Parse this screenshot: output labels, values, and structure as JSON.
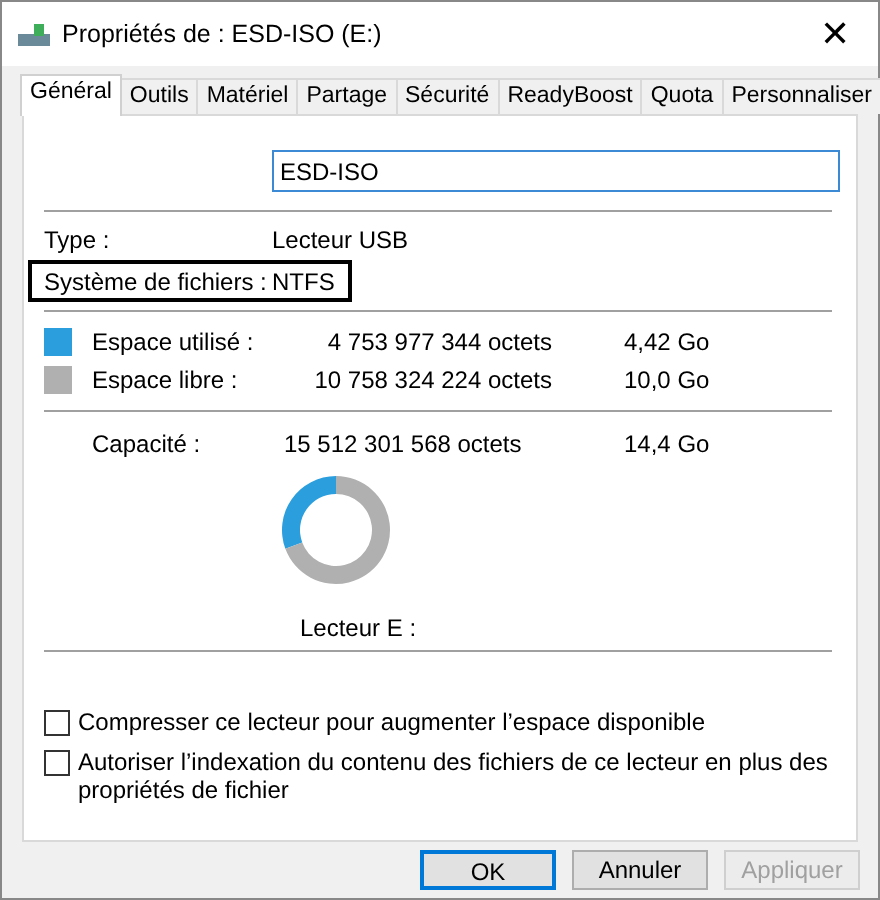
{
  "window": {
    "title": "Propriétés de : ESD-ISO (E:)",
    "close": "✕"
  },
  "tabs": [
    {
      "label": "Général",
      "selected": true
    },
    {
      "label": "Outils",
      "selected": false
    },
    {
      "label": "Matériel",
      "selected": false
    },
    {
      "label": "Partage",
      "selected": false
    },
    {
      "label": "Sécurité",
      "selected": false
    },
    {
      "label": "ReadyBoost",
      "selected": false
    },
    {
      "label": "Quota",
      "selected": false
    },
    {
      "label": "Personnaliser",
      "selected": false
    }
  ],
  "name_field": {
    "value": "ESD-ISO"
  },
  "properties": [
    {
      "label": "Type :",
      "value": "Lecteur USB",
      "highlighted": false
    },
    {
      "label": "Système de fichiers :",
      "value": "NTFS",
      "highlighted": true
    }
  ],
  "space": [
    {
      "label": "Espace utilisé :",
      "bytes": "4 753 977 344 octets",
      "size": "4,42 Go",
      "color": "#2b9ede"
    },
    {
      "label": "Espace libre :",
      "bytes": "10 758 324 224 octets",
      "size": "10,0 Go",
      "color": "#b0b0b0"
    }
  ],
  "capacity": {
    "label": "Capacité :",
    "bytes": "15 512 301 568 octets",
    "size": "14,4 Go"
  },
  "chart_data": {
    "type": "donut",
    "values": [
      30.65,
      69.35
    ]
  },
  "drive_label": "Lecteur E :",
  "options": [
    {
      "label": "Compresser ce lecteur pour augmenter l’espace disponible",
      "checked": false
    },
    {
      "label": "Autoriser l’indexation du contenu des fichiers de ce lecteur en plus des propriétés de fichier",
      "checked": false
    }
  ],
  "buttons": [
    {
      "label": "OK",
      "default": true,
      "disabled": false
    },
    {
      "label": "Annuler",
      "default": false,
      "disabled": false
    },
    {
      "label": "Appliquer",
      "default": false,
      "disabled": true
    }
  ]
}
